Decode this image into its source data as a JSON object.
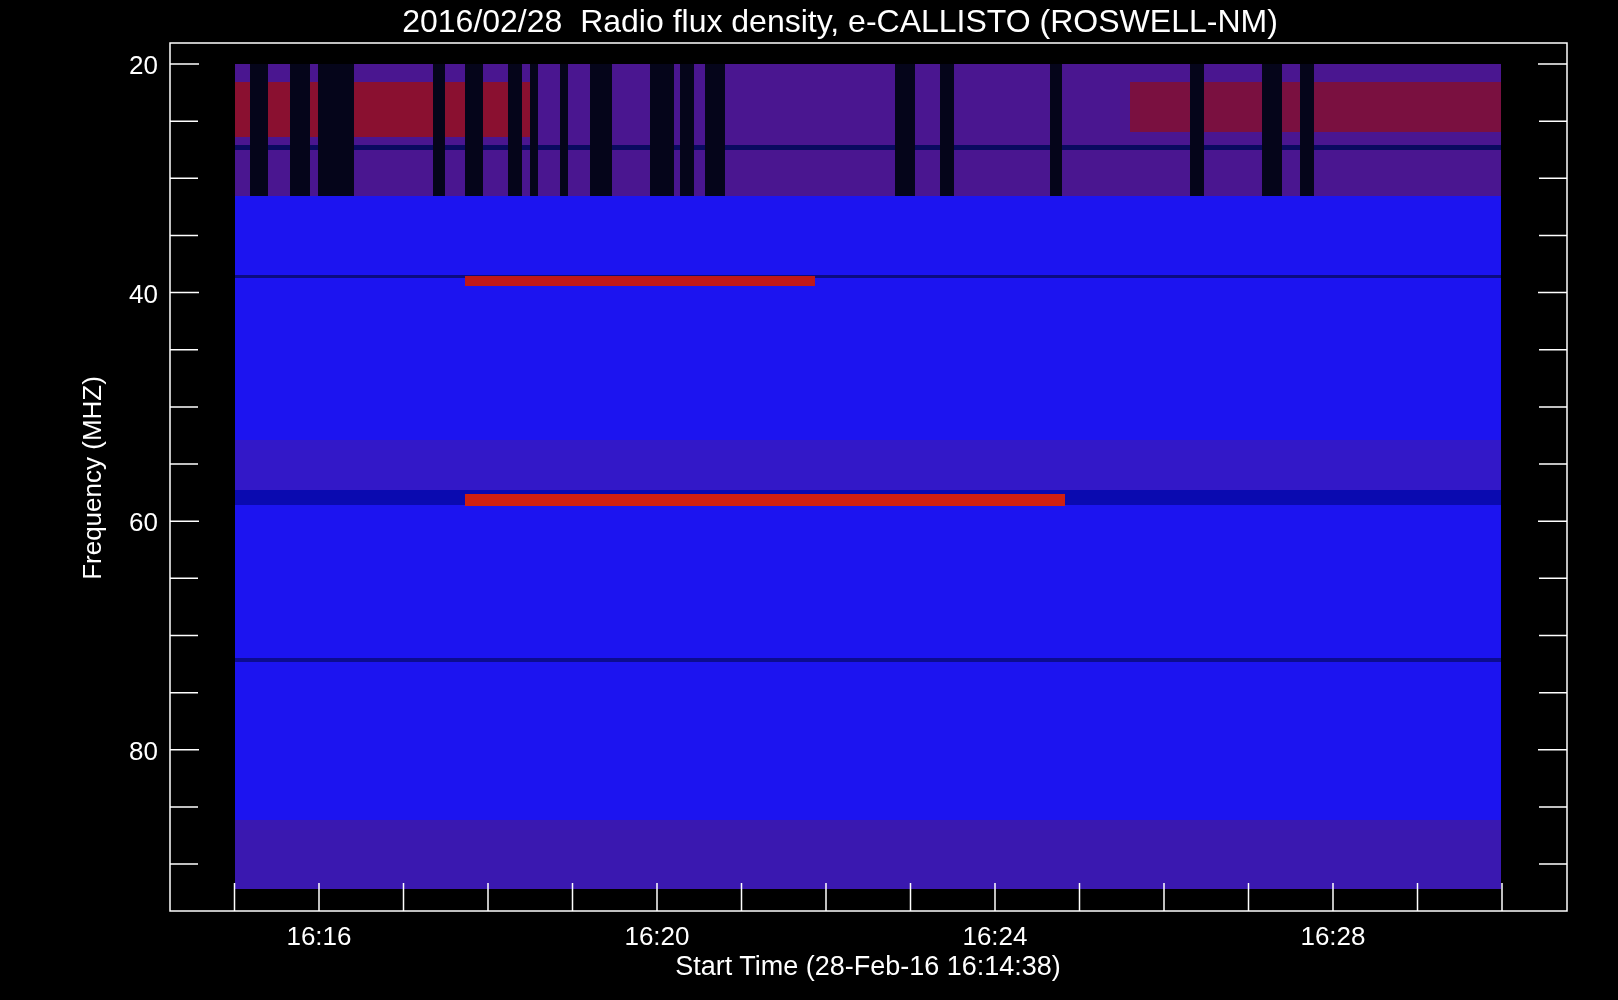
{
  "title": "2016/02/28  Radio flux density, e-CALLISTO (ROSWELL-NM)",
  "y_axis": {
    "label": "Frequency (MHZ)",
    "ticks": [
      "20",
      "40",
      "60",
      "80"
    ]
  },
  "x_axis": {
    "label": "Start Time (28-Feb-16 16:14:38)",
    "ticks": [
      "16:16",
      "16:20",
      "16:24",
      "16:28"
    ]
  }
}
